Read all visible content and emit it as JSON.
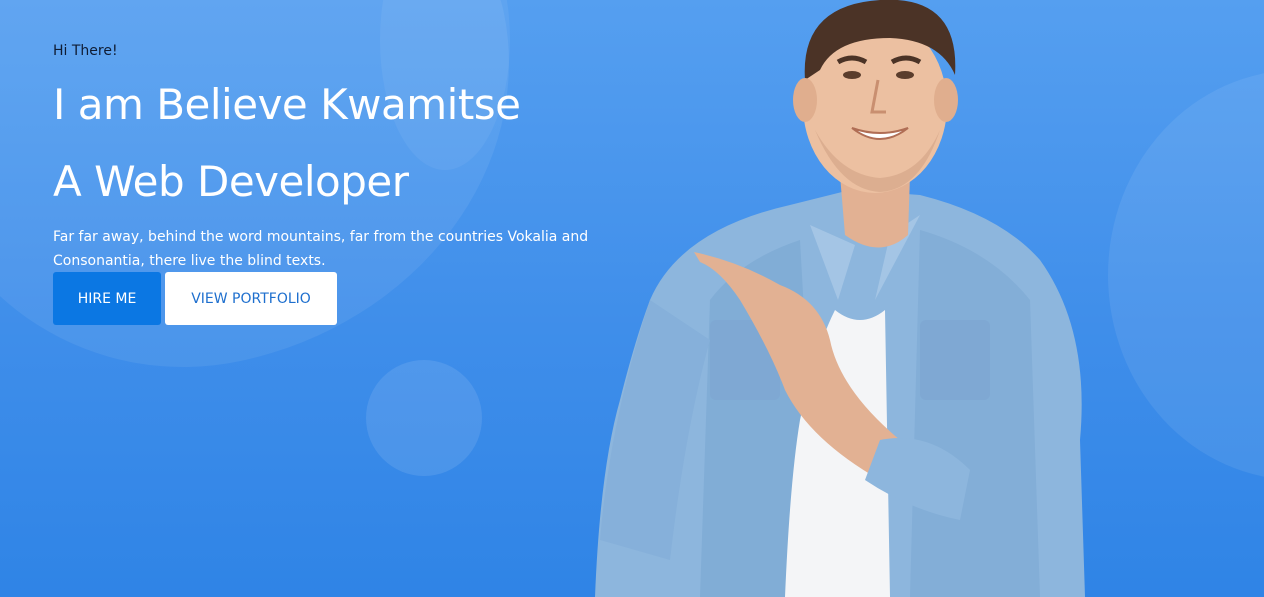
{
  "hero": {
    "greeting": "Hi There!",
    "headline_line1": "I am Believe Kwamitse",
    "headline_line2": "A Web Developer",
    "description": "Far far away, behind the word mountains, far from the countries Vokalia and Consonantia, there live the blind texts.",
    "buttons": {
      "hire_label": "HIRE ME",
      "portfolio_label": "VIEW PORTFOLIO"
    },
    "image": {
      "description_icon": "smiling-man-pointing-image"
    }
  },
  "colors": {
    "background": "#4a97ec",
    "primary_button": "#0b77e3",
    "outline_button_text": "#1e6fce",
    "heading": "#ffffff"
  }
}
